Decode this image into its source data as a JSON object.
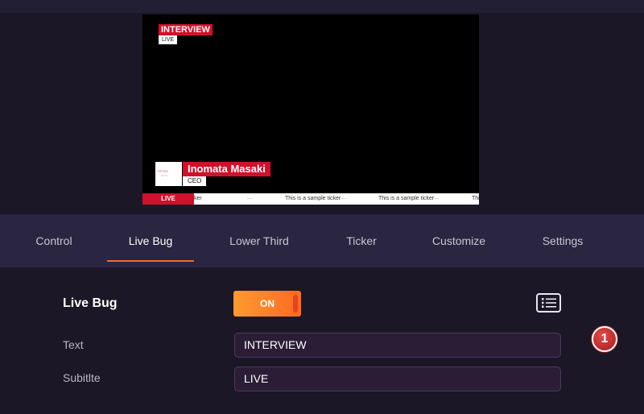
{
  "preview": {
    "live_bug": {
      "title": "INTERVIEW",
      "subtitle": "LIVE"
    },
    "lower_third": {
      "name": "Inomata Masaki",
      "title": "CEO",
      "logo_text": "ionas",
      "logo_sub": "ARTS"
    },
    "ticker": {
      "label": "LIVE",
      "fragment": "ker",
      "messages": [
        "This is a sample ticker",
        "This is a sample ticker",
        "This is a sample ticker"
      ],
      "separator": "—"
    }
  },
  "tabs": [
    {
      "label": "Control",
      "active": false
    },
    {
      "label": "Live Bug",
      "active": true
    },
    {
      "label": "Lower Third",
      "active": false
    },
    {
      "label": "Ticker",
      "active": false
    },
    {
      "label": "Customize",
      "active": false
    },
    {
      "label": "Settings",
      "active": false
    }
  ],
  "form": {
    "heading": "Live Bug",
    "toggle_label": "ON",
    "text_label": "Text",
    "text_value": "INTERVIEW",
    "subtitle_label": "Subitlte",
    "subtitle_value": "LIVE",
    "list_icon": "list-icon"
  },
  "badge": {
    "number": "1"
  },
  "colors": {
    "accent": "#f26a2a",
    "bug_red": "#d0112b",
    "toggle": "#ff7a26"
  }
}
